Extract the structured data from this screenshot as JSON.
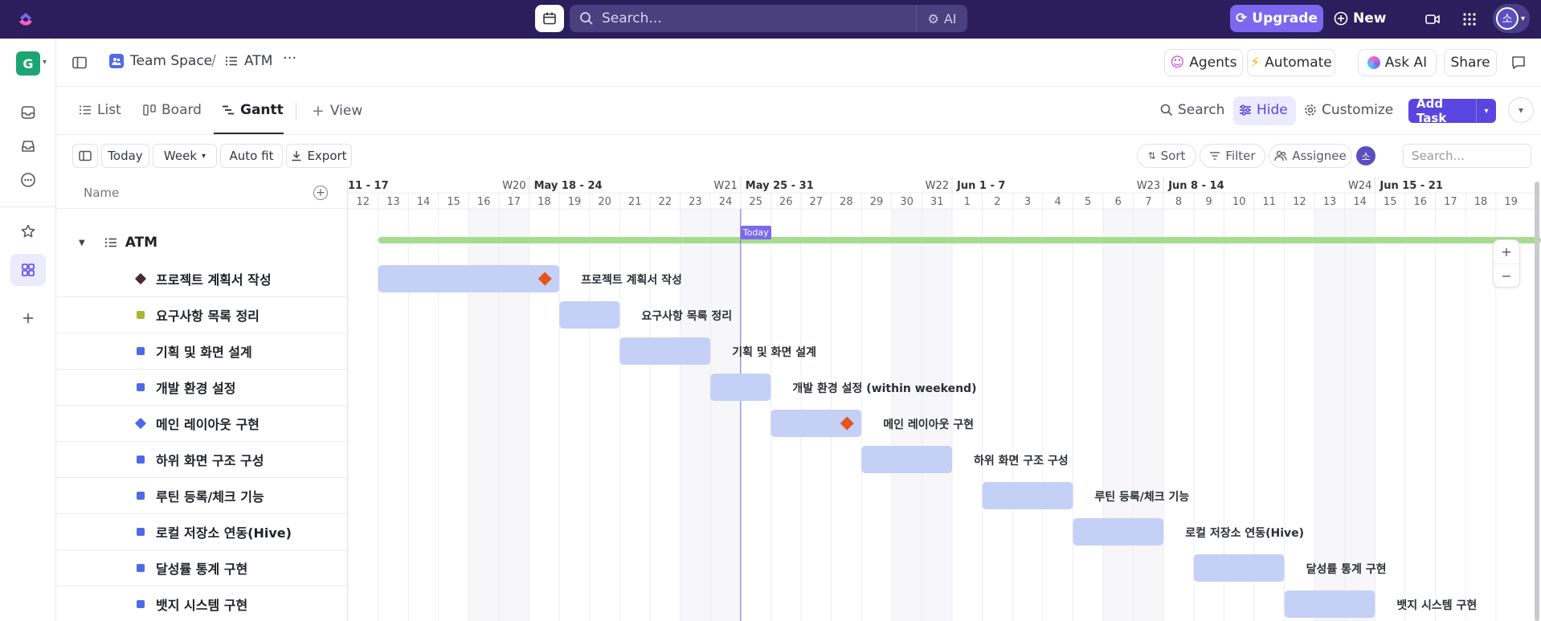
{
  "topbar": {
    "search_placeholder": "Search...",
    "ai_label": "AI",
    "upgrade_label": "Upgrade",
    "new_label": "New",
    "user_initial": "소"
  },
  "rail": {
    "workspace_initial": "G"
  },
  "breadcrumb": {
    "space": "Team Space",
    "separator": "/",
    "list": "ATM",
    "more": "···"
  },
  "header_actions": {
    "agents": "Agents",
    "automate": "Automate",
    "ask_ai": "Ask AI",
    "share": "Share"
  },
  "tabs": [
    {
      "label": "List",
      "active": false
    },
    {
      "label": "Board",
      "active": false
    },
    {
      "label": "Gantt",
      "active": true
    },
    {
      "label": "View",
      "active": false
    }
  ],
  "tab_actions": {
    "search": "Search",
    "hide": "Hide",
    "customize": "Customize",
    "add_task": "Add Task"
  },
  "toolbar": {
    "today": "Today",
    "week": "Week",
    "auto_fit": "Auto fit",
    "export": "Export",
    "sort": "Sort",
    "filter": "Filter",
    "assignee": "Assignee",
    "assignee_initial": "소",
    "search_placeholder": "Search..."
  },
  "name_column": {
    "header": "Name",
    "group_name": "ATM"
  },
  "timeline": {
    "today_label": "Today",
    "weeks": [
      {
        "label": "11 - 17",
        "wk": "W20",
        "start_index": 0
      },
      {
        "label": "May 18 - 24",
        "wk": "W21",
        "start_index": 6
      },
      {
        "label": "May 25 - 31",
        "wk": "W22",
        "start_index": 13
      },
      {
        "label": "Jun 1 - 7",
        "wk": "W23",
        "start_index": 20
      },
      {
        "label": "Jun 8 - 14",
        "wk": "W24",
        "start_index": 27
      },
      {
        "label": "Jun 15 - 21",
        "wk": "",
        "start_index": 34
      }
    ],
    "days": [
      "12",
      "13",
      "14",
      "15",
      "16",
      "17",
      "18",
      "19",
      "20",
      "21",
      "22",
      "23",
      "24",
      "25",
      "26",
      "27",
      "28",
      "29",
      "30",
      "31",
      "1",
      "2",
      "3",
      "4",
      "5",
      "6",
      "7",
      "8",
      "9",
      "10",
      "11",
      "12",
      "13",
      "14",
      "15",
      "16",
      "17",
      "18",
      "19"
    ],
    "today_index": 13
  },
  "tasks": [
    {
      "name": "프로젝트 계획서 작성",
      "bar_label": "프로젝트 계획서 작성",
      "color": "#4a2a2a",
      "shape": "diamond",
      "start": 1,
      "days": 6,
      "milestone": true
    },
    {
      "name": "요구사항 목록 정리",
      "bar_label": "요구사항 목록 정리",
      "color": "#a9b830",
      "shape": "square",
      "start": 7,
      "days": 2,
      "milestone": false
    },
    {
      "name": "기획 및 화면 설계",
      "bar_label": "기획 및 화면 설계",
      "color": "#4f6ae8",
      "shape": "square",
      "start": 9,
      "days": 3,
      "milestone": false
    },
    {
      "name": "개발 환경 설정",
      "bar_label": "개발 환경 설정 (within weekend)",
      "color": "#4f6ae8",
      "shape": "square",
      "start": 12,
      "days": 2,
      "milestone": false
    },
    {
      "name": "메인 레이아웃 구현",
      "bar_label": "메인 레이아웃 구현",
      "color": "#4f6ae8",
      "shape": "diamond",
      "start": 14,
      "days": 3,
      "milestone": true
    },
    {
      "name": "하위 화면 구조 구성",
      "bar_label": "하위 화면 구조 구성",
      "color": "#4f6ae8",
      "shape": "square",
      "start": 17,
      "days": 3,
      "milestone": false
    },
    {
      "name": "루틴 등록/체크 기능",
      "bar_label": "루틴 등록/체크 기능",
      "color": "#4f6ae8",
      "shape": "square",
      "start": 21,
      "days": 3,
      "milestone": false
    },
    {
      "name": "로컬 저장소 연동(Hive)",
      "bar_label": "로컬 저장소 연동(Hive)",
      "color": "#4f6ae8",
      "shape": "square",
      "start": 24,
      "days": 3,
      "milestone": false
    },
    {
      "name": "달성률 통계 구현",
      "bar_label": "달성률 통계 구현",
      "color": "#4f6ae8",
      "shape": "square",
      "start": 28,
      "days": 3,
      "milestone": false
    },
    {
      "name": "뱃지 시스템 구현",
      "bar_label": "뱃지 시스템 구현",
      "color": "#4f6ae8",
      "shape": "square",
      "start": 31,
      "days": 3,
      "milestone": false
    }
  ],
  "colors": {
    "bar": "#c5d0f7",
    "group_bar": "#a6dc8e",
    "milestone": "#e6541b",
    "today_line": "#7b68ee",
    "weekend_bg": "#f7f7f9"
  }
}
